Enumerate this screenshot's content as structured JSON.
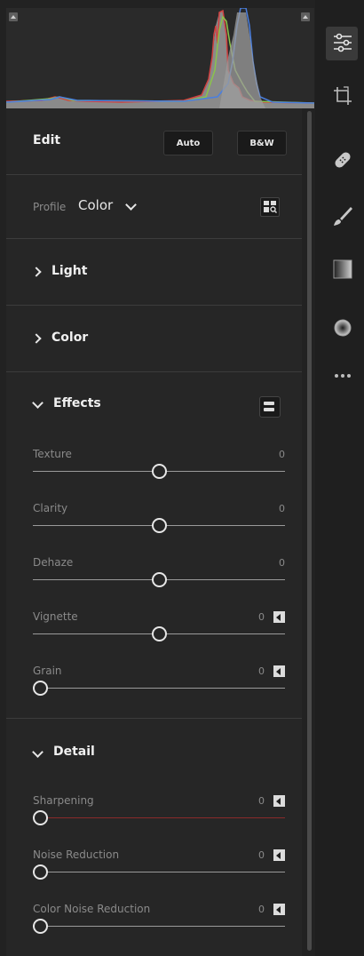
{
  "edit_panel": {
    "title": "Edit",
    "auto_label": "Auto",
    "bw_label": "B&W"
  },
  "profile": {
    "label": "Profile",
    "value": "Color"
  },
  "sections": {
    "light": "Light",
    "color": "Color",
    "effects": "Effects",
    "detail": "Detail"
  },
  "effects_sliders": [
    {
      "label": "Texture",
      "value": "0",
      "position": 0.5
    },
    {
      "label": "Clarity",
      "value": "0",
      "position": 0.5
    },
    {
      "label": "Dehaze",
      "value": "0",
      "position": 0.5
    },
    {
      "label": "Vignette",
      "value": "0",
      "position": 0.5
    },
    {
      "label": "Grain",
      "value": "0",
      "position": 0.0
    }
  ],
  "detail_sliders": [
    {
      "label": "Sharpening",
      "value": "0",
      "position": 0.0
    },
    {
      "label": "Noise Reduction",
      "value": "0",
      "position": 0.0
    },
    {
      "label": "Color Noise Reduction",
      "value": "0",
      "position": 0.0
    }
  ],
  "toolbar": {
    "items": [
      "edit-sliders-icon",
      "crop-icon",
      "healing-bandage-icon",
      "brush-icon",
      "linear-gradient-icon",
      "radial-gradient-icon",
      "more-icon"
    ]
  },
  "colors": {
    "panel_bg": "#262626",
    "text": "#e6e6e6",
    "muted": "#8a8a8a",
    "sharpening_track": "#8a2a2a"
  }
}
